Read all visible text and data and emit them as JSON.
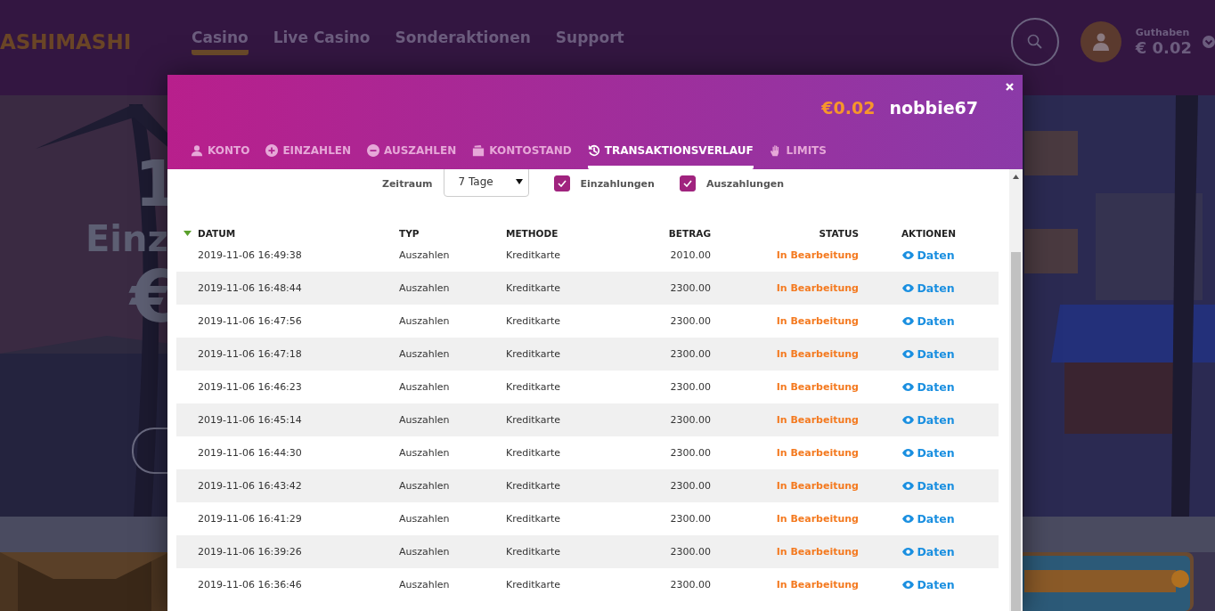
{
  "header": {
    "logo": "ASHIMASHI",
    "nav": [
      {
        "label": "Casino",
        "selected": true
      },
      {
        "label": "Live Casino",
        "selected": false
      },
      {
        "label": "Sonderaktionen",
        "selected": false
      },
      {
        "label": "Support",
        "selected": false
      }
    ],
    "balance_label": "Guthaben",
    "balance": "€ 0.02"
  },
  "hero": {
    "lines": [
      "1",
      "Einz",
      "€"
    ]
  },
  "modal": {
    "balance": "€0.02",
    "username": "nobbie67",
    "tabs": [
      {
        "label": "KONTO",
        "selected": false
      },
      {
        "label": "EINZAHLEN",
        "selected": false
      },
      {
        "label": "AUSZAHLEN",
        "selected": false
      },
      {
        "label": "KONTOSTAND",
        "selected": false
      },
      {
        "label": "TRANSAKTIONSVERLAUF",
        "selected": true
      },
      {
        "label": "LIMITS",
        "selected": false
      }
    ],
    "filters": {
      "period_label": "Zeitraum",
      "period_value": "7 Tage",
      "checkboxes": [
        {
          "label": "Einzahlungen",
          "checked": true
        },
        {
          "label": "Auszahlungen",
          "checked": true
        }
      ]
    },
    "table": {
      "columns": [
        "DATUM",
        "TYP",
        "METHODE",
        "BETRAG",
        "STATUS",
        "AKTIONEN"
      ],
      "rows": [
        {
          "datum": "2019-11-06 16:49:38",
          "typ": "Auszahlen",
          "methode": "Kreditkarte",
          "betrag": "2010.00",
          "status": "In Bearbeitung",
          "action": "Daten"
        },
        {
          "datum": "2019-11-06 16:48:44",
          "typ": "Auszahlen",
          "methode": "Kreditkarte",
          "betrag": "2300.00",
          "status": "In Bearbeitung",
          "action": "Daten"
        },
        {
          "datum": "2019-11-06 16:47:56",
          "typ": "Auszahlen",
          "methode": "Kreditkarte",
          "betrag": "2300.00",
          "status": "In Bearbeitung",
          "action": "Daten"
        },
        {
          "datum": "2019-11-06 16:47:18",
          "typ": "Auszahlen",
          "methode": "Kreditkarte",
          "betrag": "2300.00",
          "status": "In Bearbeitung",
          "action": "Daten"
        },
        {
          "datum": "2019-11-06 16:46:23",
          "typ": "Auszahlen",
          "methode": "Kreditkarte",
          "betrag": "2300.00",
          "status": "In Bearbeitung",
          "action": "Daten"
        },
        {
          "datum": "2019-11-06 16:45:14",
          "typ": "Auszahlen",
          "methode": "Kreditkarte",
          "betrag": "2300.00",
          "status": "In Bearbeitung",
          "action": "Daten"
        },
        {
          "datum": "2019-11-06 16:44:30",
          "typ": "Auszahlen",
          "methode": "Kreditkarte",
          "betrag": "2300.00",
          "status": "In Bearbeitung",
          "action": "Daten"
        },
        {
          "datum": "2019-11-06 16:43:42",
          "typ": "Auszahlen",
          "methode": "Kreditkarte",
          "betrag": "2300.00",
          "status": "In Bearbeitung",
          "action": "Daten"
        },
        {
          "datum": "2019-11-06 16:41:29",
          "typ": "Auszahlen",
          "methode": "Kreditkarte",
          "betrag": "2300.00",
          "status": "In Bearbeitung",
          "action": "Daten"
        },
        {
          "datum": "2019-11-06 16:39:26",
          "typ": "Auszahlen",
          "methode": "Kreditkarte",
          "betrag": "2300.00",
          "status": "In Bearbeitung",
          "action": "Daten"
        },
        {
          "datum": "2019-11-06 16:36:46",
          "typ": "Auszahlen",
          "methode": "Kreditkarte",
          "betrag": "2300.00",
          "status": "In Bearbeitung",
          "action": "Daten"
        }
      ]
    }
  }
}
